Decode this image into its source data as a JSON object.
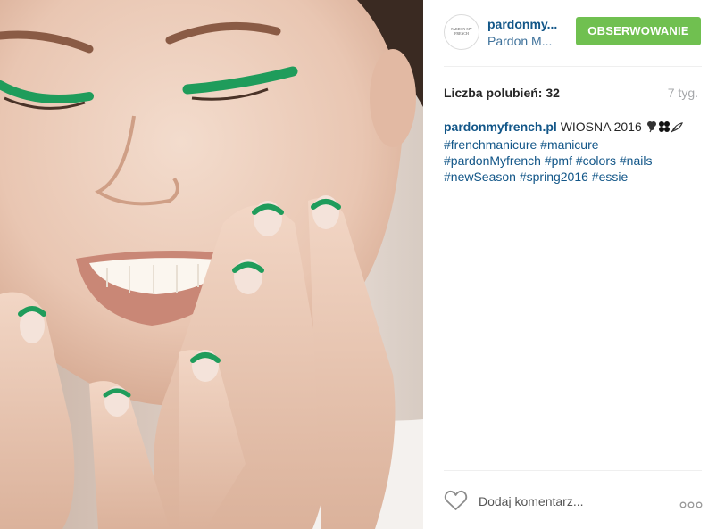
{
  "post": {
    "author_username": "pardonmy...",
    "author_fullname": "Pardon M...",
    "avatar_text": "PARDON MY FRENCH",
    "follow_label": "OBSERWOWANIE",
    "likes_text": "Liczba polubień: 32",
    "time_ago": "7 tyg.",
    "caption": {
      "author": "pardonmyfrench.pl",
      "text": "WIOSNA 2016",
      "emoji_icons": [
        "shamrock-icon",
        "clover-icon",
        "seedling-icon"
      ],
      "hashtags": [
        "#frenchmanicure",
        "#manicure",
        "#pardonMyfrench",
        "#pmf",
        "#colors",
        "#nails",
        "#newSeason",
        "#spring2016",
        "#essie"
      ]
    },
    "comment_placeholder": "Dodaj komentarz...",
    "more_icon": "more-options-icon",
    "like_icon": "heart-icon"
  },
  "colors": {
    "link": "#125688",
    "follow_button": "#70c050",
    "nail_green": "#1f9c5b",
    "divider": "#efefef"
  }
}
